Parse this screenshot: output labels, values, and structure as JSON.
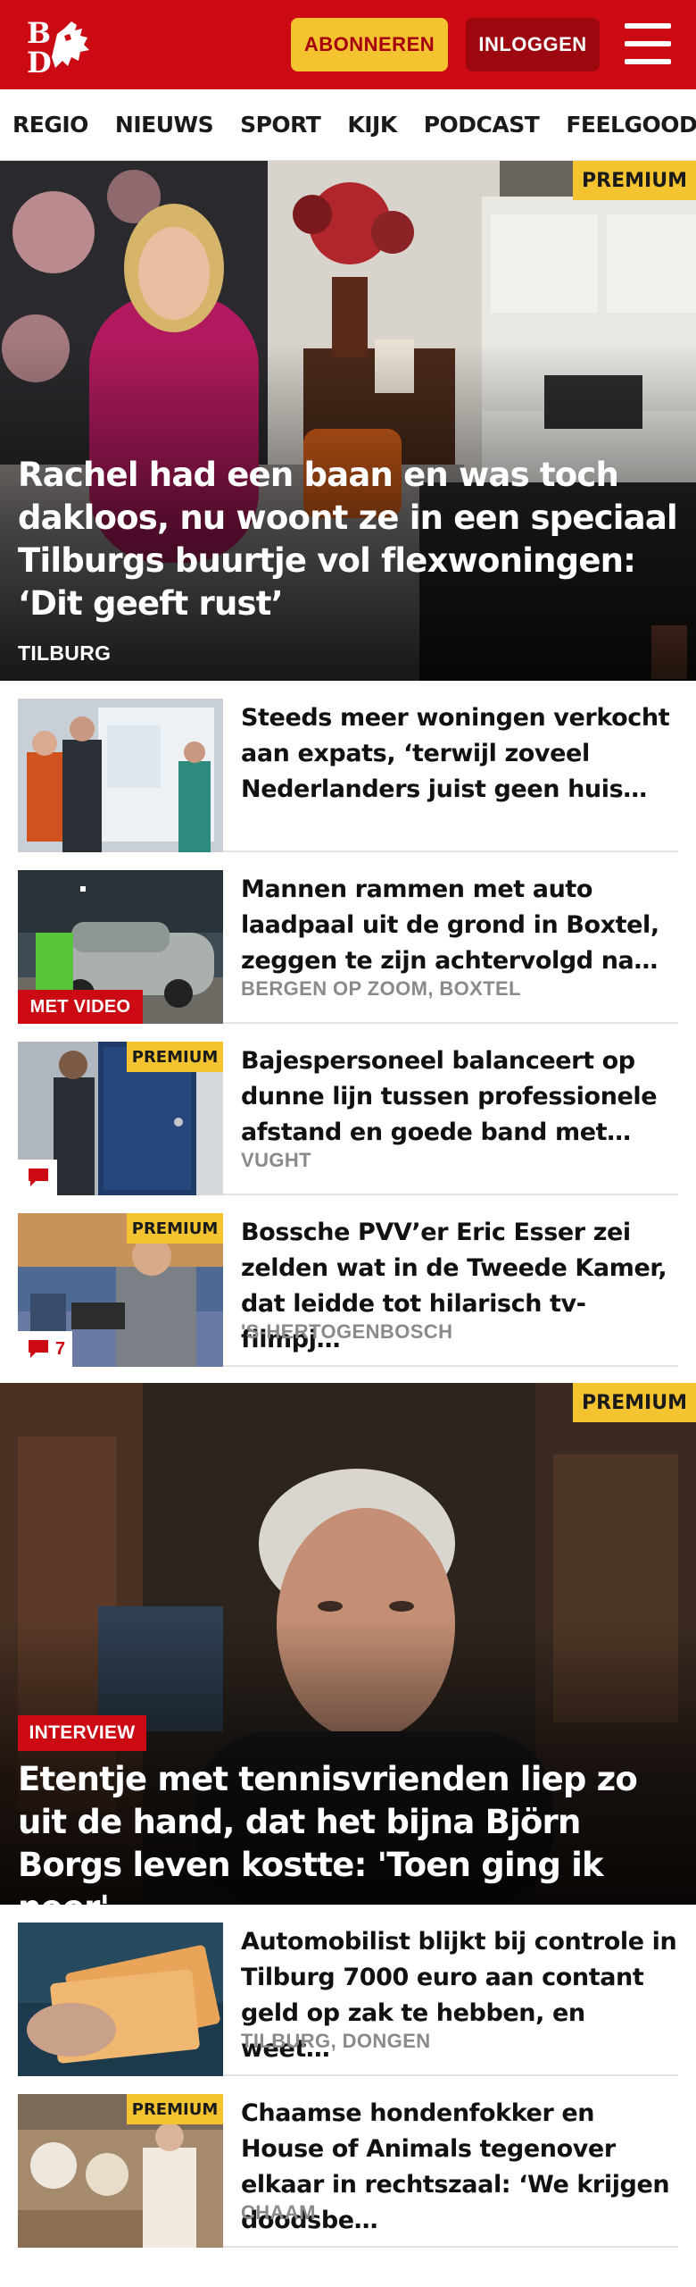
{
  "header": {
    "logo_text": "BD",
    "subscribe_label": "ABONNEREN",
    "login_label": "INLOGGEN",
    "brand_color": "#cc0a14",
    "accent_color": "#f4c330"
  },
  "nav": {
    "items": [
      "REGIO",
      "NIEUWS",
      "SPORT",
      "KIJK",
      "PODCAST",
      "FEELGOOD"
    ]
  },
  "hero": {
    "badge": "PREMIUM",
    "title": "Rachel had een baan en was toch dakloos, nu woont ze in een speciaal Tilburgs buurtje vol flexwoningen: ‘Dit geeft rust’",
    "location": "TILBURG"
  },
  "articles_top": [
    {
      "title": "Steeds meer woningen verkocht aan expats, ‘terwijl zoveel Nederlanders juist geen huis…",
      "location": "",
      "badge": "",
      "video": "",
      "comments": ""
    },
    {
      "title": "Mannen rammen met auto laadpaal uit de grond in Boxtel, zeggen te zijn achtervolgd na…",
      "location": "BERGEN OP ZOOM, BOXTEL",
      "badge": "",
      "video": "MET VIDEO",
      "comments": ""
    },
    {
      "title": "Bajespersoneel balanceert op dunne lijn tussen professionele afstand en goede band met…",
      "location": "VUGHT",
      "badge": "PREMIUM",
      "video": "",
      "comments": ""
    },
    {
      "title": "Bossche PVV’er Eric Esser zei zelden wat in de Tweede Kamer, dat leidde tot hilarisch tv-filmpj…",
      "location": "'S-HERTOGENBOSCH",
      "badge": "PREMIUM",
      "video": "",
      "comments": "7"
    }
  ],
  "feature": {
    "badge": "PREMIUM",
    "label": "INTERVIEW",
    "title": "Etentje met tennisvrienden liep zo uit de hand, dat het bijna Björn Borgs leven kostte: 'Toen ging ik neer'"
  },
  "articles_bottom": [
    {
      "title": "Automobilist blijkt bij controle in Tilburg 7000 euro aan contant geld op zak te hebben, en weet…",
      "location": "TILBURG, DONGEN",
      "badge": ""
    },
    {
      "title": "Chaamse hondenfokker en House of Animals tegenover elkaar in rechtszaal: ‘We krijgen doodsbe…",
      "location": "CHAAM",
      "badge": "PREMIUM"
    }
  ],
  "icons": {
    "menu": "hamburger-icon",
    "comment": "comment-icon",
    "logo": "bd-lion-logo"
  }
}
